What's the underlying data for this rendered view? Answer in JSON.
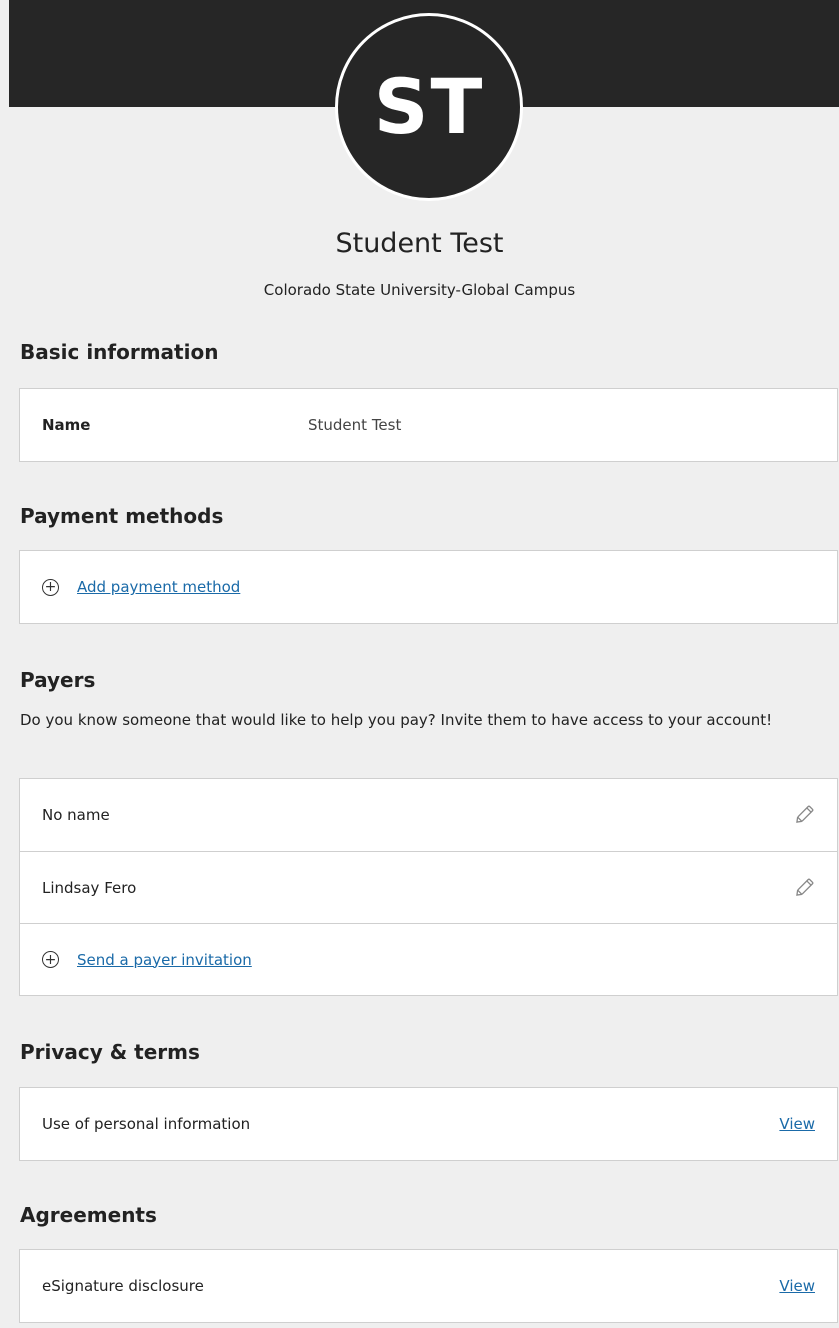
{
  "header": {
    "initials": "ST"
  },
  "profile": {
    "name": "Student Test",
    "school": "Colorado State University-Global Campus"
  },
  "basic_information": {
    "title": "Basic information",
    "fields": [
      {
        "label": "Name",
        "value": "Student Test"
      }
    ]
  },
  "payment_methods": {
    "title": "Payment methods",
    "add_label": "Add payment method",
    "add_icon": "plus-circle-icon"
  },
  "payers": {
    "title": "Payers",
    "description": "Do you know someone that would like to help you pay? Invite them to have access to your account!",
    "items": [
      {
        "name": "No name",
        "icon": "pencil-icon"
      },
      {
        "name": "Lindsay Fero",
        "icon": "pencil-icon"
      }
    ],
    "invite_label": "Send a payer invitation",
    "invite_icon": "plus-circle-icon"
  },
  "privacy_terms": {
    "title": "Privacy & terms",
    "items": [
      {
        "label": "Use of personal information",
        "action": "View"
      }
    ]
  },
  "agreements": {
    "title": "Agreements",
    "items": [
      {
        "label": "eSignature disclosure",
        "action": "View"
      }
    ]
  },
  "colors": {
    "header_bg": "#262626",
    "page_bg": "#efefef",
    "link": "#1a6aa8",
    "border": "#cfcfcf"
  }
}
